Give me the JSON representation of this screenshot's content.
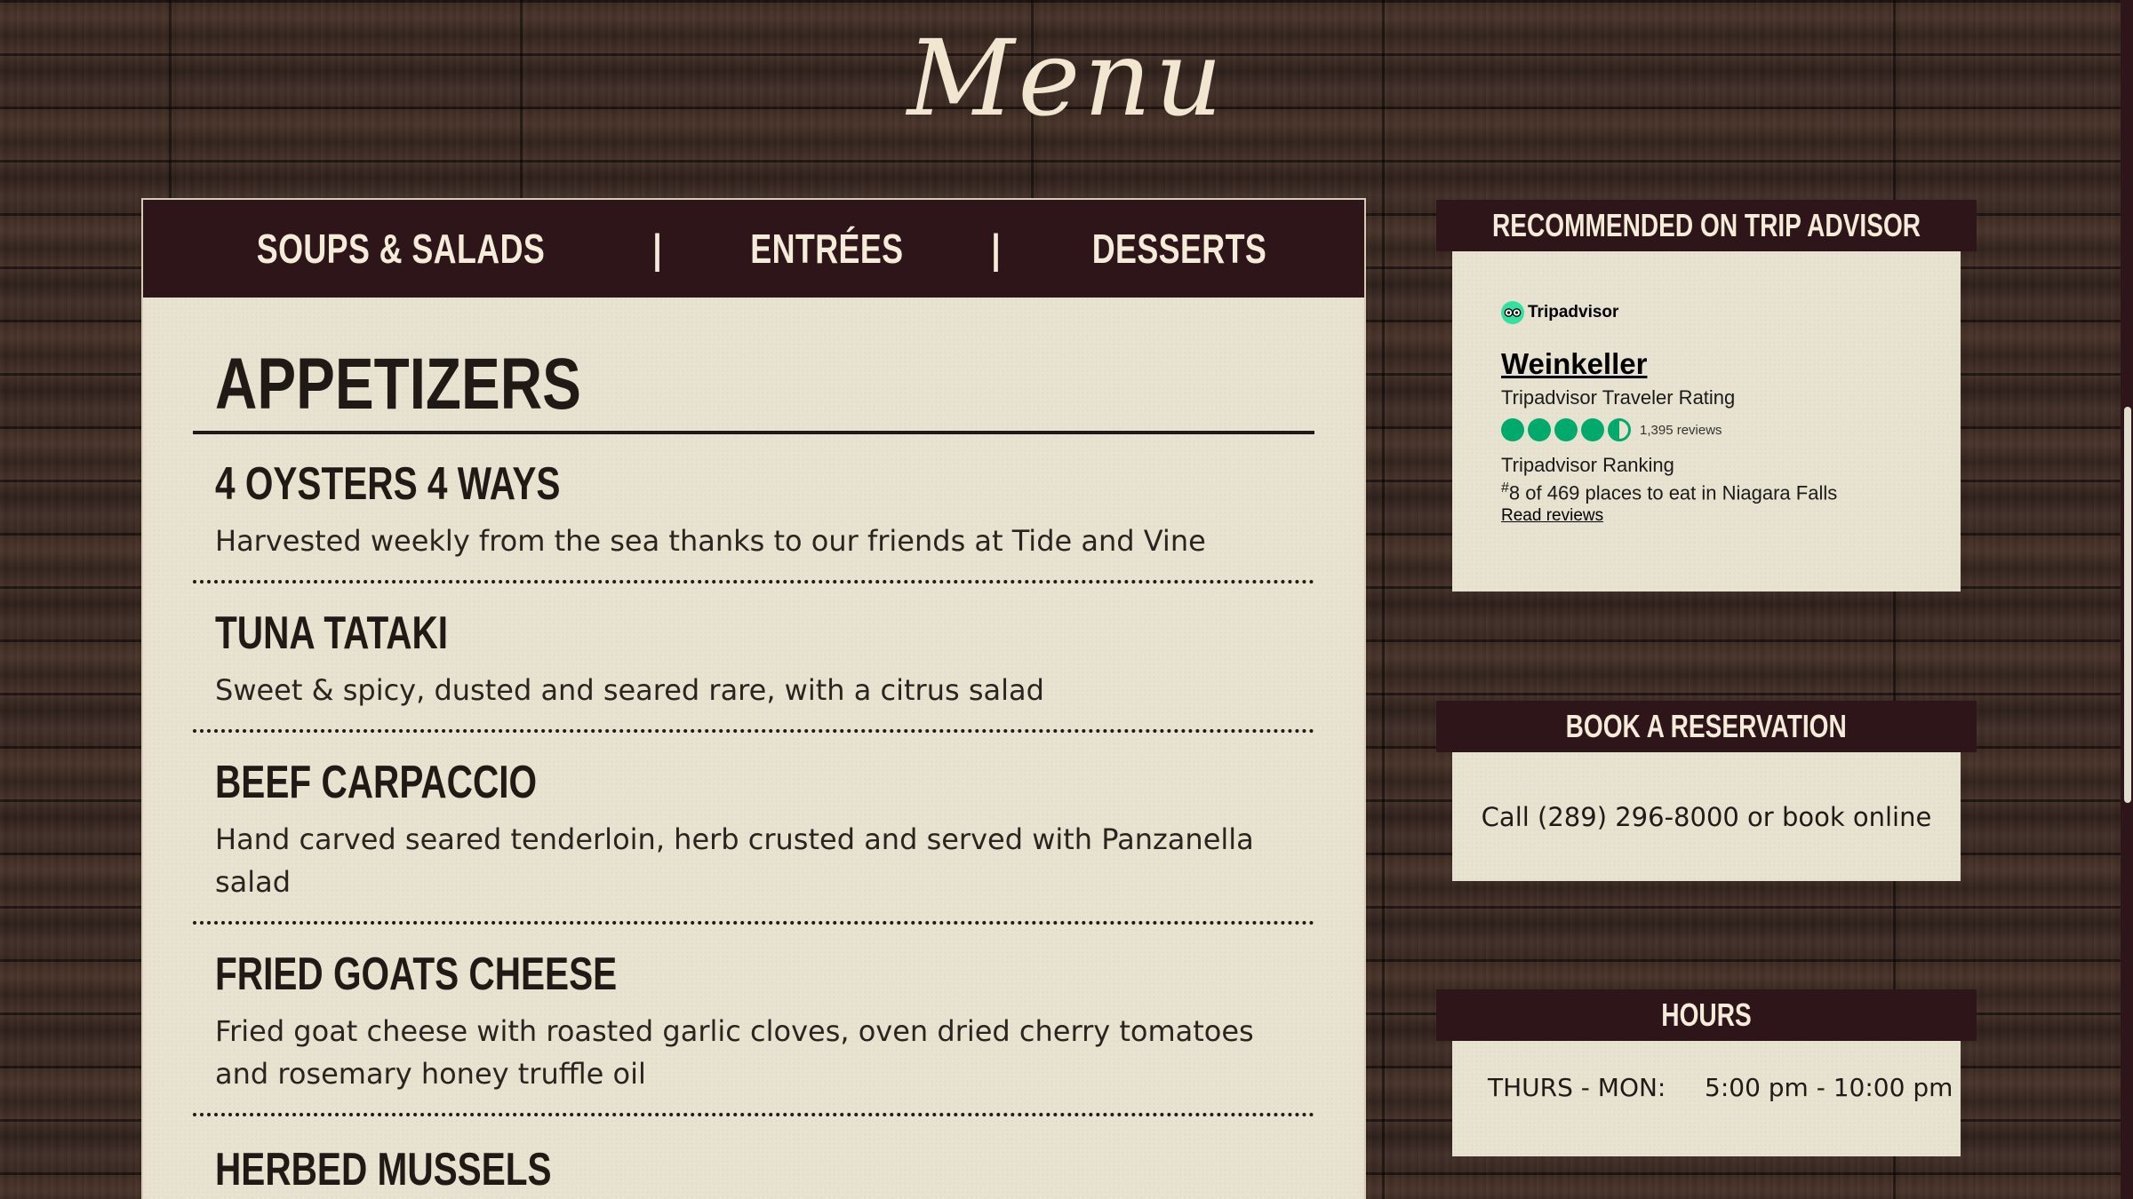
{
  "page": {
    "title": "Menu"
  },
  "tabs": [
    {
      "label": "SOUPS & SALADS"
    },
    {
      "label": "ENTRÉES"
    },
    {
      "label": "DESSERTS"
    }
  ],
  "tab_separator": "|",
  "menu": {
    "section_title": "APPETIZERS",
    "items": [
      {
        "name": "4 OYSTERS 4 WAYS",
        "description": "Harvested weekly from the sea thanks to our friends at Tide and Vine"
      },
      {
        "name": "TUNA TATAKI",
        "description": "Sweet & spicy, dusted and seared rare, with a citrus salad"
      },
      {
        "name": "BEEF CARPACCIO",
        "description": "Hand carved seared tenderloin, herb crusted and served with Panzanella salad"
      },
      {
        "name": "FRIED GOATS CHEESE",
        "description": "Fried goat cheese with roasted garlic cloves, oven dried cherry tomatoes and rosemary honey truffle oil"
      },
      {
        "name": "HERBED MUSSELS",
        "description": ""
      }
    ]
  },
  "tripadvisor": {
    "header": "RECOMMENDED ON TRIP ADVISOR",
    "logo_text": "Tripadvisor",
    "restaurant_name": "Weinkeller",
    "rating_label": "Tripadvisor Traveler Rating",
    "rating": 4.5,
    "rating_max": 5,
    "reviews": "1,395 reviews",
    "ranking_label": "Tripadvisor Ranking",
    "ranking_hash": "#",
    "ranking_text": "8 of 469 places to eat in Niagara Falls",
    "read_reviews": "Read reviews",
    "brand_color": "#00aa6c"
  },
  "reservation": {
    "header": "BOOK A RESERVATION",
    "text": "Call (289) 296-8000 or book online"
  },
  "hours": {
    "header": "HOURS",
    "days": "THURS - MON:",
    "time": "5:00 pm - 10:00 pm"
  },
  "colors": {
    "header_bg": "#2d1519",
    "panel_bg": "#e8e2d0",
    "text_dark": "#201a17",
    "text_light": "#f4ecd9"
  }
}
